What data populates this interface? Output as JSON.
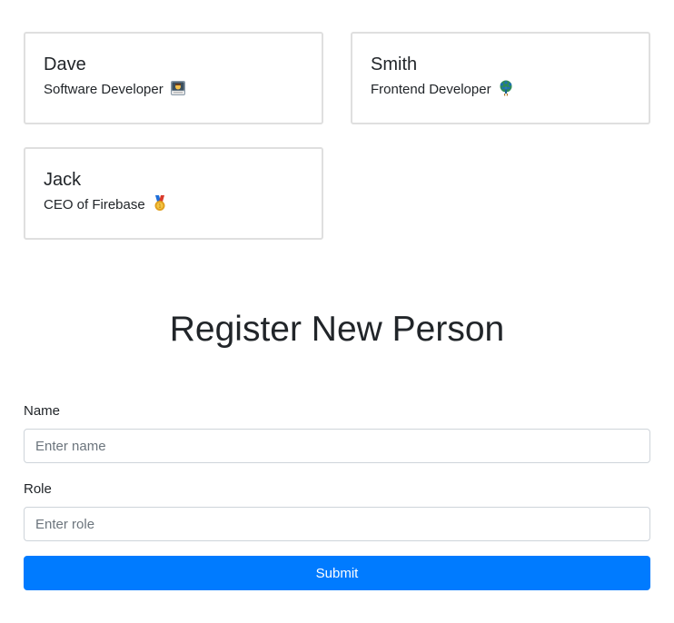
{
  "people": [
    {
      "name": "Dave",
      "role": "Software Developer",
      "icon": "technologist-emoji-icon"
    },
    {
      "name": "Smith",
      "role": "Frontend Developer",
      "icon": "peacock-emoji-icon"
    },
    {
      "name": "Jack",
      "role": "CEO of Firebase",
      "icon": "medal-emoji-icon"
    }
  ],
  "form": {
    "heading": "Register New Person",
    "name_label": "Name",
    "name_placeholder": "Enter name",
    "name_value": "",
    "role_label": "Role",
    "role_placeholder": "Enter role",
    "role_value": "",
    "submit_label": "Submit"
  },
  "colors": {
    "accent": "#007bff",
    "card_border": "#dfdfdf",
    "input_border": "#ced4da"
  }
}
